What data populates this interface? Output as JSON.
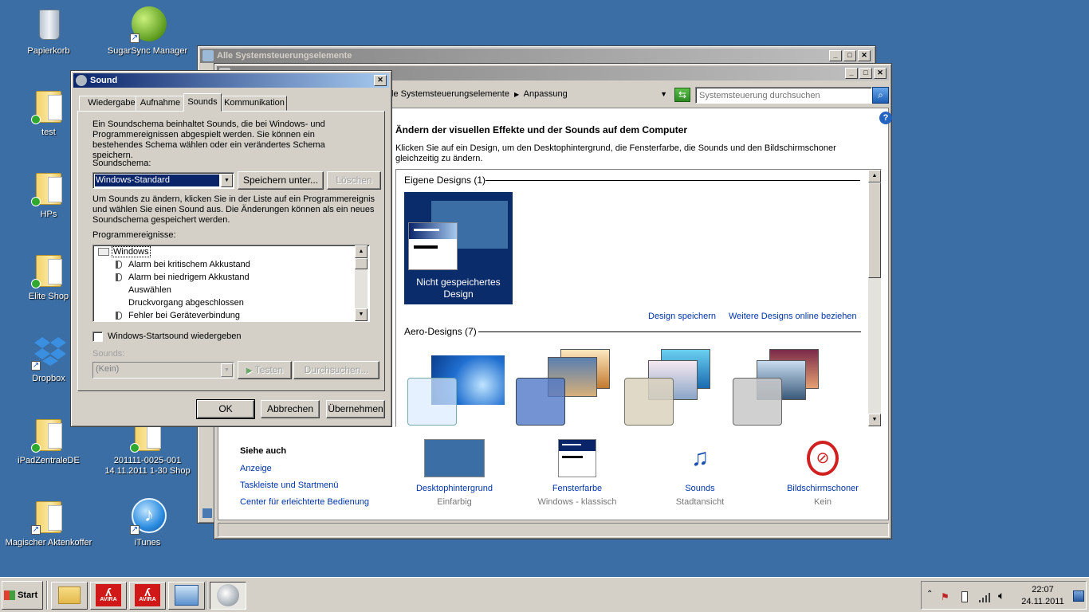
{
  "desktop": {
    "icons": [
      {
        "label": "Papierkorb"
      },
      {
        "label": "SugarSync Manager"
      },
      {
        "label": "test"
      },
      {
        "label": "HPs"
      },
      {
        "label": "Elite Shop"
      },
      {
        "label": "Dropbox"
      },
      {
        "label": "iPadZentraleDE"
      },
      {
        "label": "201111-0025-001\n14.11.2011 1-30 Shop"
      },
      {
        "label": "Magischer Aktenkoffer"
      },
      {
        "label": "iTunes"
      }
    ]
  },
  "back_window": {
    "title": "Alle Systemsteuerungselemente"
  },
  "personalization": {
    "breadcrumb_part1": "le Systemsteuerungselemente",
    "breadcrumb_part2": "Anpassung",
    "search_placeholder": "Systemsteuerung durchsuchen",
    "heading": "Ändern der visuellen Effekte und der Sounds auf dem Computer",
    "description": "Klicken Sie auf ein Design, um den Desktophintergrund, die Fensterfarbe, die Sounds und den Bildschirmschoner gleichzeitig zu ändern.",
    "my_designs_label": "Eigene Designs (1)",
    "unsaved_design_label": "Nicht gespeichertes Design",
    "save_design_link": "Design speichern",
    "more_designs_link": "Weitere Designs online beziehen",
    "aero_designs_label": "Aero-Designs (7)",
    "see_also": {
      "heading": "Siehe auch",
      "links": [
        "Anzeige",
        "Taskleiste und Startmenü",
        "Center für erleichterte Bedienung"
      ]
    },
    "bottom_items": [
      {
        "title": "Desktophintergrund",
        "sub": "Einfarbig"
      },
      {
        "title": "Fensterfarbe",
        "sub": "Windows - klassisch"
      },
      {
        "title": "Sounds",
        "sub": "Stadtansicht"
      },
      {
        "title": "Bildschirmschoner",
        "sub": "Kein"
      }
    ]
  },
  "sound_dialog": {
    "title": "Sound",
    "tabs": [
      "Wiedergabe",
      "Aufnahme",
      "Sounds",
      "Kommunikation"
    ],
    "active_tab": "Sounds",
    "intro": "Ein Soundschema beinhaltet Sounds, die bei Windows- und Programmereignissen abgespielt werden. Sie können ein bestehendes Schema wählen oder ein verändertes Schema speichern.",
    "scheme_label": "Soundschema:",
    "scheme_value": "Windows-Standard",
    "save_as_label": "Speichern unter...",
    "delete_label": "Löschen",
    "change_text": "Um Sounds zu ändern, klicken Sie in der Liste auf ein Programmereignis und wählen Sie einen Sound aus. Die Änderungen können als ein neues Soundschema gespeichert werden.",
    "events_label": "Programmereignisse:",
    "events_root": "Windows",
    "events": [
      {
        "label": "Alarm bei kritischem Akkustand",
        "has_sound": true
      },
      {
        "label": "Alarm bei niedrigem Akkustand",
        "has_sound": true
      },
      {
        "label": "Auswählen",
        "has_sound": false
      },
      {
        "label": "Druckvorgang abgeschlossen",
        "has_sound": false
      },
      {
        "label": "Fehler bei Geräteverbindung",
        "has_sound": true
      }
    ],
    "startup_sound_label": "Windows-Startsound wiedergeben",
    "sounds_label": "Sounds:",
    "sounds_value": "(Kein)",
    "test_label": "Testen",
    "browse_label": "Durchsuchen...",
    "ok_label": "OK",
    "cancel_label": "Abbrechen",
    "apply_label": "Übernehmen"
  },
  "taskbar": {
    "start_label": "Start",
    "apps": [
      {
        "icon": "explorer-icon"
      },
      {
        "icon": "avira-icon",
        "text": "AVIRA"
      },
      {
        "icon": "avira-icon",
        "text": "AVIRA"
      },
      {
        "icon": "control-panel-icon"
      },
      {
        "icon": "speaker-icon"
      }
    ],
    "time": "22:07",
    "date": "24.11.2011"
  }
}
